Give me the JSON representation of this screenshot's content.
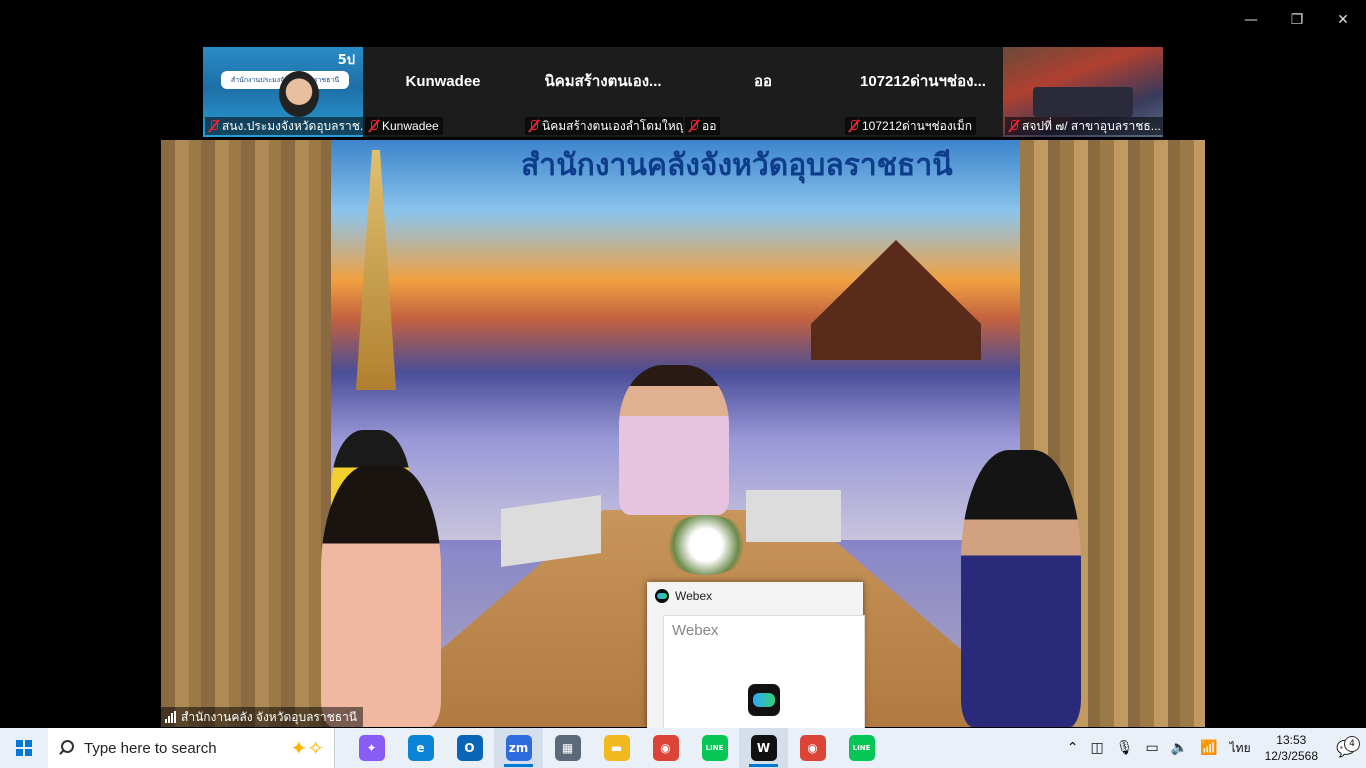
{
  "window_controls": {
    "minimize": "—",
    "restore": "❐",
    "close": "✕"
  },
  "gallery": [
    {
      "name": "",
      "label": "สนง.ประมงจังหวัดอุบลราช...",
      "type": "video",
      "banner": "สำนักงานประมงจังหวัดอุบลราชธานี",
      "badge": "5ป"
    },
    {
      "name": "Kunwadee",
      "label": "Kunwadee",
      "type": "name"
    },
    {
      "name": "นิคมสร้างตนเอง...",
      "label": "นิคมสร้างตนเองลำโดมใหญ่...",
      "type": "name"
    },
    {
      "name": "ออ",
      "label": "ออ",
      "type": "name"
    },
    {
      "name": "107212ด่านฯช่อง...",
      "label": "107212ด่านฯช่องเม็ก",
      "type": "name"
    },
    {
      "name": "",
      "label": "สจปที่ ๗/ สาขาอุบลราชธ...",
      "type": "video"
    }
  ],
  "main_video": {
    "backdrop_title": "สำนักงานคลังจังหวัดอุบลราชธานี",
    "participant_name": "สำนักงานคลัง จังหวัดอุบลราชธานี"
  },
  "webex_popup": {
    "title": "Webex",
    "preview_text": "Webex"
  },
  "taskbar": {
    "search_placeholder": "Type here to search",
    "apps": [
      {
        "name": "copilot-icon",
        "color": "#8a5cf6",
        "glyph": "✦"
      },
      {
        "name": "edge-icon",
        "color": "#0b84d8",
        "glyph": "e"
      },
      {
        "name": "outlook-icon",
        "color": "#0a64b8",
        "glyph": "O"
      },
      {
        "name": "zoom-icon",
        "color": "#2d6cdf",
        "glyph": "zm",
        "active": true
      },
      {
        "name": "calculator-icon",
        "color": "#5a6a7a",
        "glyph": "▦"
      },
      {
        "name": "file-explorer-icon",
        "color": "#f2b820",
        "glyph": "▬"
      },
      {
        "name": "chrome-icon",
        "color": "#db4437",
        "glyph": "◉"
      },
      {
        "name": "line-icon",
        "color": "#06c755",
        "glyph": "LINE"
      },
      {
        "name": "webex-icon",
        "color": "#111111",
        "glyph": "W",
        "active": true
      },
      {
        "name": "chrome-profile-icon",
        "color": "#db4437",
        "glyph": "◉"
      },
      {
        "name": "line-icon-2",
        "color": "#06c755",
        "glyph": "LINE"
      }
    ],
    "tray": {
      "language": "ไทย",
      "time": "13:53",
      "date": "12/3/2568",
      "notifications": "4"
    }
  }
}
